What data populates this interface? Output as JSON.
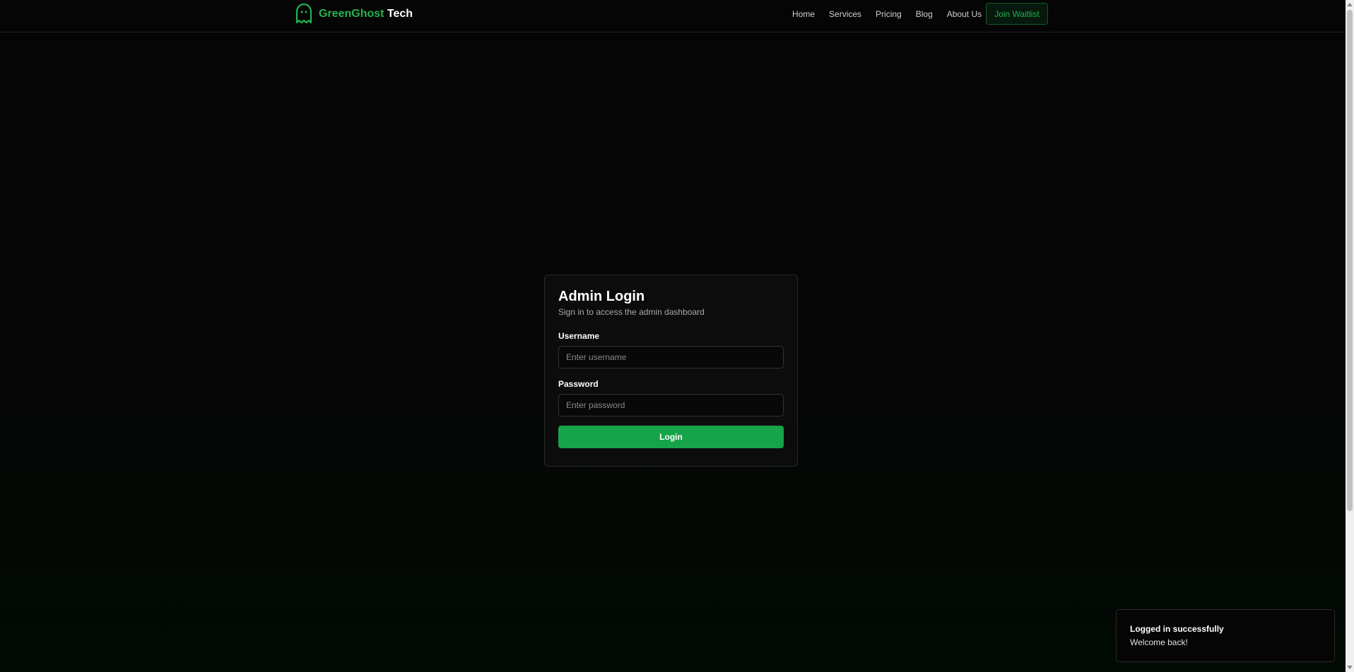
{
  "header": {
    "brand_primary": "GreenGhost",
    "brand_secondary": "Tech",
    "logo_icon": "ghost-icon",
    "nav_items": [
      {
        "label": "Home"
      },
      {
        "label": "Services"
      },
      {
        "label": "Pricing"
      },
      {
        "label": "Blog"
      },
      {
        "label": "About Us"
      }
    ],
    "cta_label": "Join Waitlist"
  },
  "login": {
    "title": "Admin Login",
    "subtitle": "Sign in to access the admin dashboard",
    "username_label": "Username",
    "username_placeholder": "Enter username",
    "username_value": "",
    "password_label": "Password",
    "password_placeholder": "Enter password",
    "password_value": "",
    "submit_label": "Login"
  },
  "toast": {
    "title": "Logged in successfully",
    "description": "Welcome back!"
  },
  "colors": {
    "accent": "#22b351",
    "button": "#17a34a",
    "background": "#050505"
  }
}
